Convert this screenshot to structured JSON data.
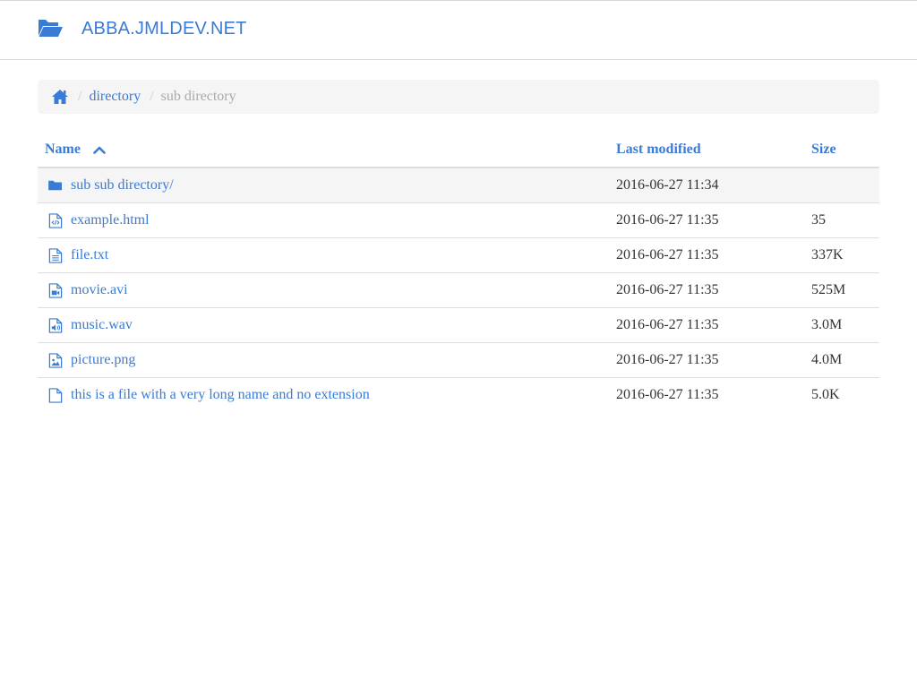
{
  "header": {
    "title": "ABBA.JMLDEV.NET",
    "icon": "folder-open-icon",
    "accent_color": "#3a7bd5"
  },
  "breadcrumb": {
    "home_icon": "home-icon",
    "items": [
      {
        "label": "directory",
        "link": true
      },
      {
        "label": "sub directory",
        "link": false
      }
    ]
  },
  "table": {
    "columns": {
      "name": "Name",
      "last_modified": "Last modified",
      "size": "Size",
      "sort_indicator": "chevron-up-icon"
    },
    "rows": [
      {
        "name": "sub sub directory/",
        "modified": "2016-06-27 11:34",
        "size": "",
        "icon": "folder-icon"
      },
      {
        "name": "example.html",
        "modified": "2016-06-27 11:35",
        "size": "35",
        "icon": "code-file-icon"
      },
      {
        "name": "file.txt",
        "modified": "2016-06-27 11:35",
        "size": "337K",
        "icon": "text-file-icon"
      },
      {
        "name": "movie.avi",
        "modified": "2016-06-27 11:35",
        "size": "525M",
        "icon": "video-file-icon"
      },
      {
        "name": "music.wav",
        "modified": "2016-06-27 11:35",
        "size": "3.0M",
        "icon": "audio-file-icon"
      },
      {
        "name": "picture.png",
        "modified": "2016-06-27 11:35",
        "size": "4.0M",
        "icon": "image-file-icon"
      },
      {
        "name": "this is a file with a very long name and no extension",
        "modified": "2016-06-27 11:35",
        "size": "5.0K",
        "icon": "file-icon"
      }
    ]
  }
}
